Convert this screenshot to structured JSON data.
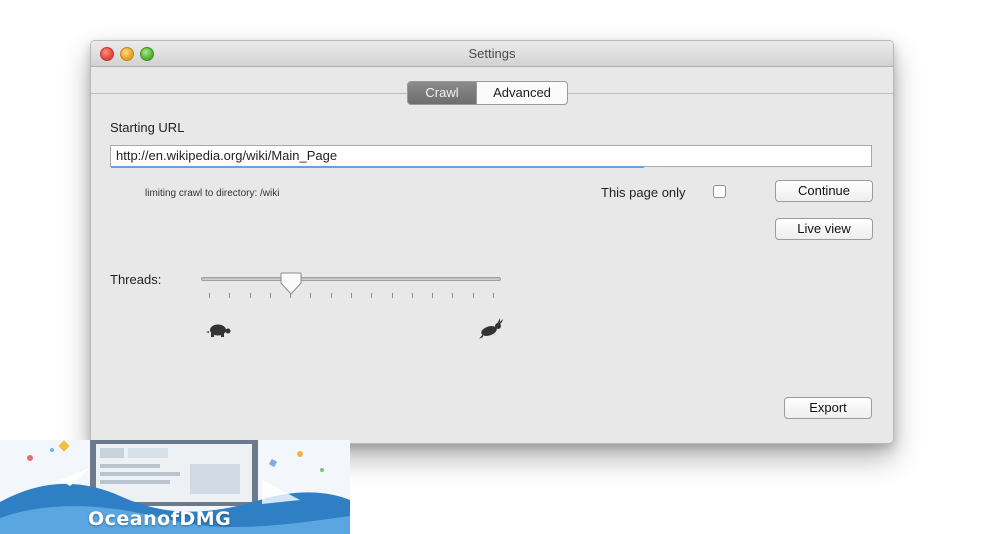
{
  "window": {
    "title": "Settings"
  },
  "tabs": [
    {
      "label": "Crawl",
      "active": true
    },
    {
      "label": "Advanced",
      "active": false
    }
  ],
  "crawl": {
    "starting_url_label": "Starting URL",
    "starting_url_value": "http://en.wikipedia.org/wiki/Main_Page",
    "url_load_progress": 0.7,
    "limit_text": "limiting crawl to directory: /wiki",
    "this_page_only_label": "This page only",
    "this_page_only_checked": false,
    "continue_label": "Continue",
    "live_view_label": "Live view",
    "threads_label": "Threads:",
    "threads_slider_fraction": 0.3,
    "threads_slider_min_icon": "turtle-icon",
    "threads_slider_max_icon": "rabbit-icon",
    "export_label": "Export"
  },
  "watermark": {
    "text": "OceanofDMG"
  },
  "colors": {
    "window_bg": "#e8e8e8",
    "active_tab": "#7c7c7c",
    "url_progress": "#6aa1dc",
    "close": "#e0443a",
    "minimize": "#e2a31d",
    "zoom": "#4fae2e"
  }
}
